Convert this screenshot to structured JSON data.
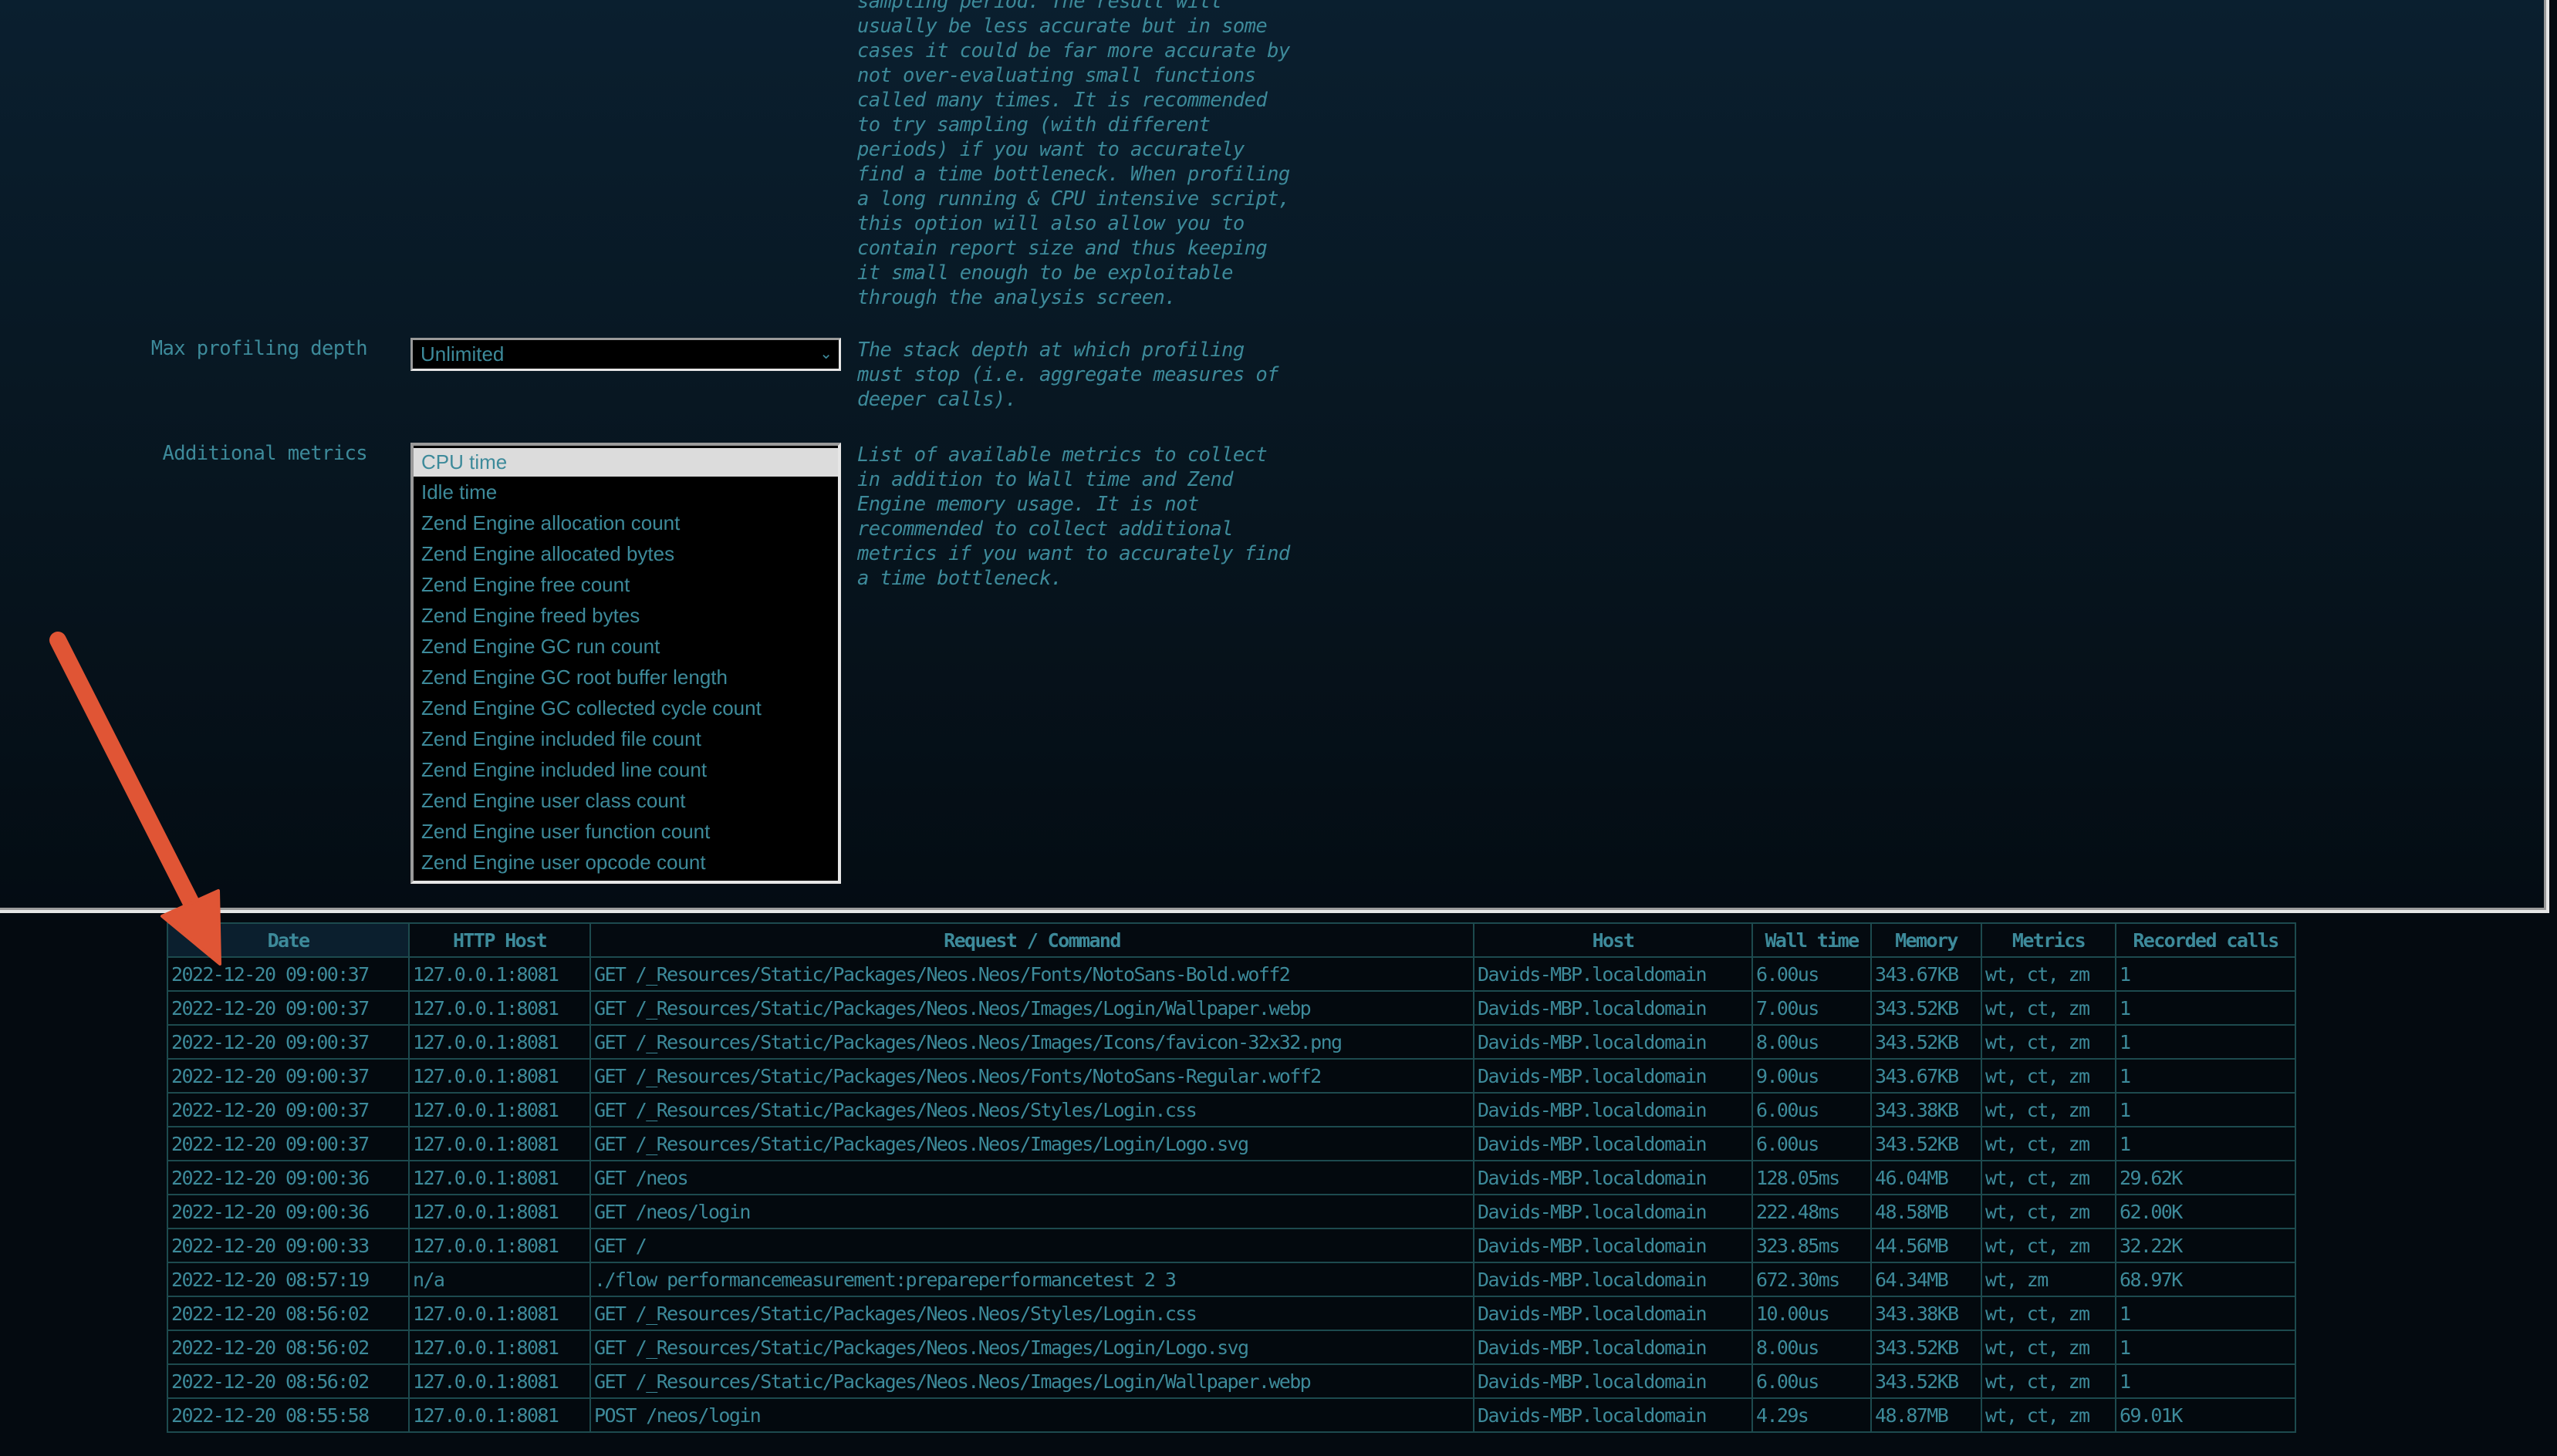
{
  "settings": {
    "sampling_description_tail": "sampling period. The result will\nusually be less accurate but in some\ncases it could be far more accurate by\nnot over-evaluating small functions\ncalled many times. It is recommended\nto try sampling (with different\nperiods) if you want to accurately\nfind a time bottleneck. When profiling\na long running & CPU intensive script,\nthis option will also allow you to\ncontain report size and thus keeping\nit small enough to be exploitable\nthrough the analysis screen.",
    "max_depth": {
      "label": "Max profiling depth",
      "value": "Unlimited",
      "description": "The stack depth at which profiling\nmust stop (i.e. aggregate measures of\ndeeper calls)."
    },
    "additional_metrics": {
      "label": "Additional metrics",
      "description": "List of available metrics to collect\nin addition to Wall time and Zend\nEngine memory usage. It is not\nrecommended to collect additional\nmetrics if you want to accurately find\na time bottleneck.",
      "options": [
        {
          "label": "CPU time",
          "selected": true
        },
        {
          "label": "Idle time",
          "selected": false
        },
        {
          "label": "Zend Engine allocation count",
          "selected": false
        },
        {
          "label": "Zend Engine allocated bytes",
          "selected": false
        },
        {
          "label": "Zend Engine free count",
          "selected": false
        },
        {
          "label": "Zend Engine freed bytes",
          "selected": false
        },
        {
          "label": "Zend Engine GC run count",
          "selected": false
        },
        {
          "label": "Zend Engine GC root buffer length",
          "selected": false
        },
        {
          "label": "Zend Engine GC collected cycle count",
          "selected": false
        },
        {
          "label": "Zend Engine included file count",
          "selected": false
        },
        {
          "label": "Zend Engine included line count",
          "selected": false
        },
        {
          "label": "Zend Engine user class count",
          "selected": false
        },
        {
          "label": "Zend Engine user function count",
          "selected": false
        },
        {
          "label": "Zend Engine user opcode count",
          "selected": false
        }
      ]
    }
  },
  "runs_table": {
    "sorted_column": "Date",
    "columns": [
      "Date",
      "HTTP Host",
      "Request / Command",
      "Host",
      "Wall time",
      "Memory",
      "Metrics",
      "Recorded calls"
    ],
    "rows": [
      [
        "2022-12-20 09:00:37",
        "127.0.0.1:8081",
        "GET /_Resources/Static/Packages/Neos.Neos/Fonts/NotoSans-Bold.woff2",
        "Davids-MBP.localdomain",
        "6.00us",
        "343.67KB",
        "wt, ct, zm",
        "1"
      ],
      [
        "2022-12-20 09:00:37",
        "127.0.0.1:8081",
        "GET /_Resources/Static/Packages/Neos.Neos/Images/Login/Wallpaper.webp",
        "Davids-MBP.localdomain",
        "7.00us",
        "343.52KB",
        "wt, ct, zm",
        "1"
      ],
      [
        "2022-12-20 09:00:37",
        "127.0.0.1:8081",
        "GET /_Resources/Static/Packages/Neos.Neos/Images/Icons/favicon-32x32.png",
        "Davids-MBP.localdomain",
        "8.00us",
        "343.52KB",
        "wt, ct, zm",
        "1"
      ],
      [
        "2022-12-20 09:00:37",
        "127.0.0.1:8081",
        "GET /_Resources/Static/Packages/Neos.Neos/Fonts/NotoSans-Regular.woff2",
        "Davids-MBP.localdomain",
        "9.00us",
        "343.67KB",
        "wt, ct, zm",
        "1"
      ],
      [
        "2022-12-20 09:00:37",
        "127.0.0.1:8081",
        "GET /_Resources/Static/Packages/Neos.Neos/Styles/Login.css",
        "Davids-MBP.localdomain",
        "6.00us",
        "343.38KB",
        "wt, ct, zm",
        "1"
      ],
      [
        "2022-12-20 09:00:37",
        "127.0.0.1:8081",
        "GET /_Resources/Static/Packages/Neos.Neos/Images/Login/Logo.svg",
        "Davids-MBP.localdomain",
        "6.00us",
        "343.52KB",
        "wt, ct, zm",
        "1"
      ],
      [
        "2022-12-20 09:00:36",
        "127.0.0.1:8081",
        "GET /neos",
        "Davids-MBP.localdomain",
        "128.05ms",
        "46.04MB",
        "wt, ct, zm",
        "29.62K"
      ],
      [
        "2022-12-20 09:00:36",
        "127.0.0.1:8081",
        "GET /neos/login",
        "Davids-MBP.localdomain",
        "222.48ms",
        "48.58MB",
        "wt, ct, zm",
        "62.00K"
      ],
      [
        "2022-12-20 09:00:33",
        "127.0.0.1:8081",
        "GET /",
        "Davids-MBP.localdomain",
        "323.85ms",
        "44.56MB",
        "wt, ct, zm",
        "32.22K"
      ],
      [
        "2022-12-20 08:57:19",
        "n/a",
        "./flow performancemeasurement:prepareperformancetest 2 3",
        "Davids-MBP.localdomain",
        "672.30ms",
        "64.34MB",
        "wt, zm",
        "68.97K"
      ],
      [
        "2022-12-20 08:56:02",
        "127.0.0.1:8081",
        "GET /_Resources/Static/Packages/Neos.Neos/Styles/Login.css",
        "Davids-MBP.localdomain",
        "10.00us",
        "343.38KB",
        "wt, ct, zm",
        "1"
      ],
      [
        "2022-12-20 08:56:02",
        "127.0.0.1:8081",
        "GET /_Resources/Static/Packages/Neos.Neos/Images/Login/Logo.svg",
        "Davids-MBP.localdomain",
        "8.00us",
        "343.52KB",
        "wt, ct, zm",
        "1"
      ],
      [
        "2022-12-20 08:56:02",
        "127.0.0.1:8081",
        "GET /_Resources/Static/Packages/Neos.Neos/Images/Login/Wallpaper.webp",
        "Davids-MBP.localdomain",
        "6.00us",
        "343.52KB",
        "wt, ct, zm",
        "1"
      ],
      [
        "2022-12-20 08:55:58",
        "127.0.0.1:8081",
        "POST /neos/login",
        "Davids-MBP.localdomain",
        "4.29s",
        "48.87MB",
        "wt, ct, zm",
        "69.01K"
      ]
    ]
  },
  "annotation": {
    "type": "arrow",
    "color": "#e05535",
    "points_to": "Date column header"
  },
  "colors": {
    "text": "#3d8a9a",
    "grid": "#1d4a4e",
    "sorted_header_bg": "#0b1f2e",
    "selected_option_bg": "#dcdcdc"
  }
}
